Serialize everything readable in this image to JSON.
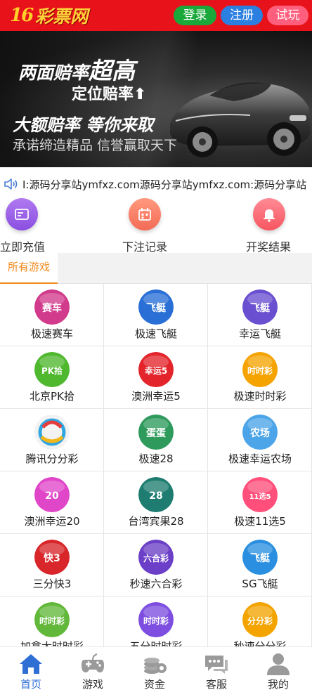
{
  "header": {
    "logo_mark": "16",
    "logo_text": "彩票网",
    "login_label": "登录",
    "register_label": "注册",
    "trial_label": "试玩",
    "colors": {
      "bar": "#e8121a",
      "login": "#1aa83a",
      "register": "#2b7fe0",
      "trial": "#ff5e7d"
    }
  },
  "banner": {
    "line1_a": "两面赔率",
    "line1_b": "超高",
    "line2": "定位赔率⬆",
    "line3": "大额赔率 等你来取",
    "line4": "承诺缔造精品 信誉赢取天下",
    "slides": 3,
    "active_slide": 2
  },
  "notice": {
    "icon": "speaker-icon",
    "text": "I:源码分享站ymfxz.com源码分享站ymfxz.com:源码分享站"
  },
  "quick_actions": [
    {
      "label": "立即充值",
      "icon": "wallet-card-icon"
    },
    {
      "label": "下注记录",
      "icon": "calendar-icon"
    },
    {
      "label": "开奖结果",
      "icon": "bell-icon"
    }
  ],
  "tabs": {
    "active": "所有游戏"
  },
  "games": [
    {
      "name": "极速赛车",
      "badge": "赛车",
      "bg": "#d23a8c"
    },
    {
      "name": "极速飞艇",
      "badge": "飞艇",
      "bg": "#2a6fd6"
    },
    {
      "name": "幸运飞艇",
      "badge": "飞艇",
      "bg": "#6a4fd0"
    },
    {
      "name": "北京PK拾",
      "badge": "PK拾",
      "bg": "#4fb82e"
    },
    {
      "name": "澳洲幸运5",
      "badge": "幸运5",
      "bg": "#e3242b"
    },
    {
      "name": "极速时时彩",
      "badge": "时时彩",
      "bg": "#f5a300"
    },
    {
      "name": "腾讯分分彩",
      "badge": "",
      "bg": "#f2f2f2"
    },
    {
      "name": "极速28",
      "badge": "蛋蛋",
      "bg": "#2e9a5c"
    },
    {
      "name": "极速幸运农场",
      "badge": "农场",
      "bg": "#4ba5e8"
    },
    {
      "name": "澳洲幸运20",
      "badge": "20",
      "bg": "#e046c8"
    },
    {
      "name": "台湾宾果28",
      "badge": "28",
      "bg": "#1e7d70"
    },
    {
      "name": "极速11选5",
      "badge": "11选5",
      "bg": "#ff4f7a"
    },
    {
      "name": "三分快3",
      "badge": "快3",
      "bg": "#d8262a"
    },
    {
      "name": "秒速六合彩",
      "badge": "六合彩",
      "bg": "#6b3fc7"
    },
    {
      "name": "SG飞艇",
      "badge": "飞艇",
      "bg": "#2a8fe0"
    },
    {
      "name": "加拿大时时彩",
      "badge": "时时彩",
      "bg": "#62b83a"
    },
    {
      "name": "五分时时彩",
      "badge": "时时彩",
      "bg": "#7d4ee0"
    },
    {
      "name": "秒速分分彩",
      "badge": "分分彩",
      "bg": "#f4a400"
    }
  ],
  "bottom_nav": [
    {
      "label": "首页",
      "icon": "home-icon",
      "active": true
    },
    {
      "label": "游戏",
      "icon": "gamepad-icon",
      "active": false
    },
    {
      "label": "资金",
      "icon": "coins-icon",
      "active": false
    },
    {
      "label": "客服",
      "icon": "chat-icon",
      "active": false
    },
    {
      "label": "我的",
      "icon": "user-icon",
      "active": false
    }
  ]
}
